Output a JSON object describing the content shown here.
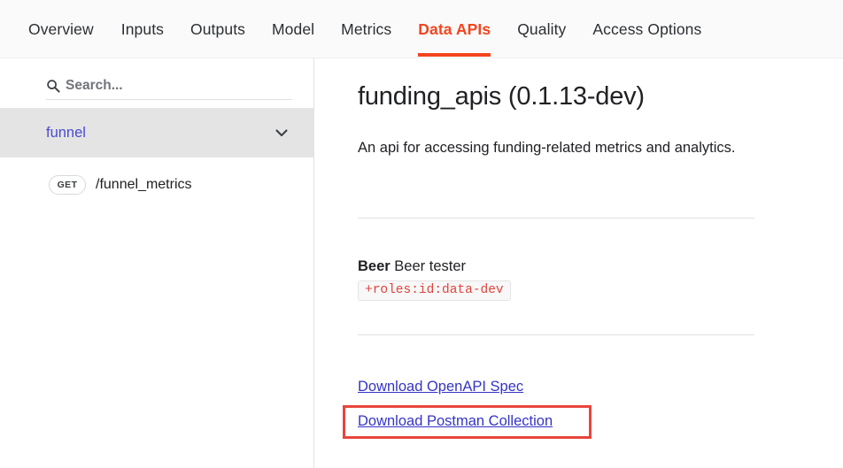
{
  "nav": {
    "tabs": [
      {
        "label": "Overview",
        "active": false
      },
      {
        "label": "Inputs",
        "active": false
      },
      {
        "label": "Outputs",
        "active": false
      },
      {
        "label": "Model",
        "active": false
      },
      {
        "label": "Metrics",
        "active": false
      },
      {
        "label": "Data APIs",
        "active": true
      },
      {
        "label": "Quality",
        "active": false
      },
      {
        "label": "Access Options",
        "active": false
      }
    ],
    "active_color": "#f4441e"
  },
  "sidebar": {
    "search": {
      "icon": "search-icon",
      "value": "",
      "placeholder": "Search..."
    },
    "group": {
      "label": "funnel",
      "expanded": true,
      "chevron_icon": "chevron-down-icon",
      "label_color": "#4a4ad0",
      "row_background": "#e4e4e4"
    },
    "endpoints": [
      {
        "method": "GET",
        "path": "/funnel_metrics"
      }
    ]
  },
  "main": {
    "title": "funding_apis (0.1.13-dev)",
    "description": "An api for accessing funding-related metrics and analytics.",
    "contact": {
      "name": "Beer",
      "role": "Beer tester",
      "roles_chip": "+roles:id:data-dev",
      "chip_text_color": "#e0443c"
    },
    "links": [
      {
        "label": "Download OpenAPI Spec"
      },
      {
        "label": "Download Postman Collection"
      }
    ],
    "link_color": "#3434c8",
    "highlight": {
      "target": "Download Postman Collection",
      "color": "#e8453c"
    }
  }
}
